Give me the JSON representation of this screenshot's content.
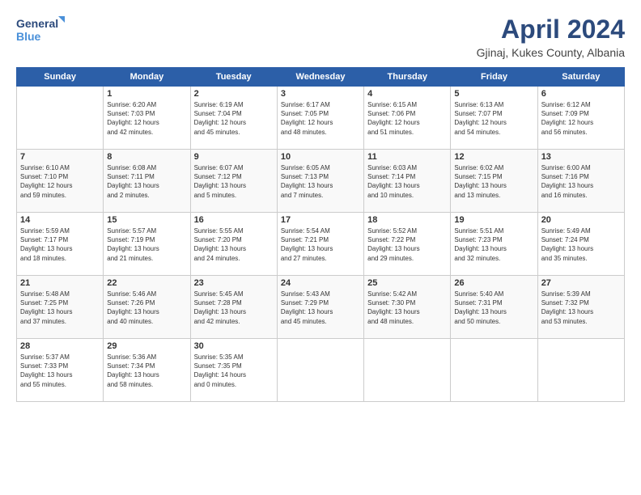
{
  "logo": {
    "line1": "General",
    "line2": "Blue"
  },
  "title": "April 2024",
  "location": "Gjinaj, Kukes County, Albania",
  "weekdays": [
    "Sunday",
    "Monday",
    "Tuesday",
    "Wednesday",
    "Thursday",
    "Friday",
    "Saturday"
  ],
  "weeks": [
    [
      {
        "day": "",
        "data": ""
      },
      {
        "day": "1",
        "data": "Sunrise: 6:20 AM\nSunset: 7:03 PM\nDaylight: 12 hours\nand 42 minutes."
      },
      {
        "day": "2",
        "data": "Sunrise: 6:19 AM\nSunset: 7:04 PM\nDaylight: 12 hours\nand 45 minutes."
      },
      {
        "day": "3",
        "data": "Sunrise: 6:17 AM\nSunset: 7:05 PM\nDaylight: 12 hours\nand 48 minutes."
      },
      {
        "day": "4",
        "data": "Sunrise: 6:15 AM\nSunset: 7:06 PM\nDaylight: 12 hours\nand 51 minutes."
      },
      {
        "day": "5",
        "data": "Sunrise: 6:13 AM\nSunset: 7:07 PM\nDaylight: 12 hours\nand 54 minutes."
      },
      {
        "day": "6",
        "data": "Sunrise: 6:12 AM\nSunset: 7:09 PM\nDaylight: 12 hours\nand 56 minutes."
      }
    ],
    [
      {
        "day": "7",
        "data": "Sunrise: 6:10 AM\nSunset: 7:10 PM\nDaylight: 12 hours\nand 59 minutes."
      },
      {
        "day": "8",
        "data": "Sunrise: 6:08 AM\nSunset: 7:11 PM\nDaylight: 13 hours\nand 2 minutes."
      },
      {
        "day": "9",
        "data": "Sunrise: 6:07 AM\nSunset: 7:12 PM\nDaylight: 13 hours\nand 5 minutes."
      },
      {
        "day": "10",
        "data": "Sunrise: 6:05 AM\nSunset: 7:13 PM\nDaylight: 13 hours\nand 7 minutes."
      },
      {
        "day": "11",
        "data": "Sunrise: 6:03 AM\nSunset: 7:14 PM\nDaylight: 13 hours\nand 10 minutes."
      },
      {
        "day": "12",
        "data": "Sunrise: 6:02 AM\nSunset: 7:15 PM\nDaylight: 13 hours\nand 13 minutes."
      },
      {
        "day": "13",
        "data": "Sunrise: 6:00 AM\nSunset: 7:16 PM\nDaylight: 13 hours\nand 16 minutes."
      }
    ],
    [
      {
        "day": "14",
        "data": "Sunrise: 5:59 AM\nSunset: 7:17 PM\nDaylight: 13 hours\nand 18 minutes."
      },
      {
        "day": "15",
        "data": "Sunrise: 5:57 AM\nSunset: 7:19 PM\nDaylight: 13 hours\nand 21 minutes."
      },
      {
        "day": "16",
        "data": "Sunrise: 5:55 AM\nSunset: 7:20 PM\nDaylight: 13 hours\nand 24 minutes."
      },
      {
        "day": "17",
        "data": "Sunrise: 5:54 AM\nSunset: 7:21 PM\nDaylight: 13 hours\nand 27 minutes."
      },
      {
        "day": "18",
        "data": "Sunrise: 5:52 AM\nSunset: 7:22 PM\nDaylight: 13 hours\nand 29 minutes."
      },
      {
        "day": "19",
        "data": "Sunrise: 5:51 AM\nSunset: 7:23 PM\nDaylight: 13 hours\nand 32 minutes."
      },
      {
        "day": "20",
        "data": "Sunrise: 5:49 AM\nSunset: 7:24 PM\nDaylight: 13 hours\nand 35 minutes."
      }
    ],
    [
      {
        "day": "21",
        "data": "Sunrise: 5:48 AM\nSunset: 7:25 PM\nDaylight: 13 hours\nand 37 minutes."
      },
      {
        "day": "22",
        "data": "Sunrise: 5:46 AM\nSunset: 7:26 PM\nDaylight: 13 hours\nand 40 minutes."
      },
      {
        "day": "23",
        "data": "Sunrise: 5:45 AM\nSunset: 7:28 PM\nDaylight: 13 hours\nand 42 minutes."
      },
      {
        "day": "24",
        "data": "Sunrise: 5:43 AM\nSunset: 7:29 PM\nDaylight: 13 hours\nand 45 minutes."
      },
      {
        "day": "25",
        "data": "Sunrise: 5:42 AM\nSunset: 7:30 PM\nDaylight: 13 hours\nand 48 minutes."
      },
      {
        "day": "26",
        "data": "Sunrise: 5:40 AM\nSunset: 7:31 PM\nDaylight: 13 hours\nand 50 minutes."
      },
      {
        "day": "27",
        "data": "Sunrise: 5:39 AM\nSunset: 7:32 PM\nDaylight: 13 hours\nand 53 minutes."
      }
    ],
    [
      {
        "day": "28",
        "data": "Sunrise: 5:37 AM\nSunset: 7:33 PM\nDaylight: 13 hours\nand 55 minutes."
      },
      {
        "day": "29",
        "data": "Sunrise: 5:36 AM\nSunset: 7:34 PM\nDaylight: 13 hours\nand 58 minutes."
      },
      {
        "day": "30",
        "data": "Sunrise: 5:35 AM\nSunset: 7:35 PM\nDaylight: 14 hours\nand 0 minutes."
      },
      {
        "day": "",
        "data": ""
      },
      {
        "day": "",
        "data": ""
      },
      {
        "day": "",
        "data": ""
      },
      {
        "day": "",
        "data": ""
      }
    ]
  ]
}
